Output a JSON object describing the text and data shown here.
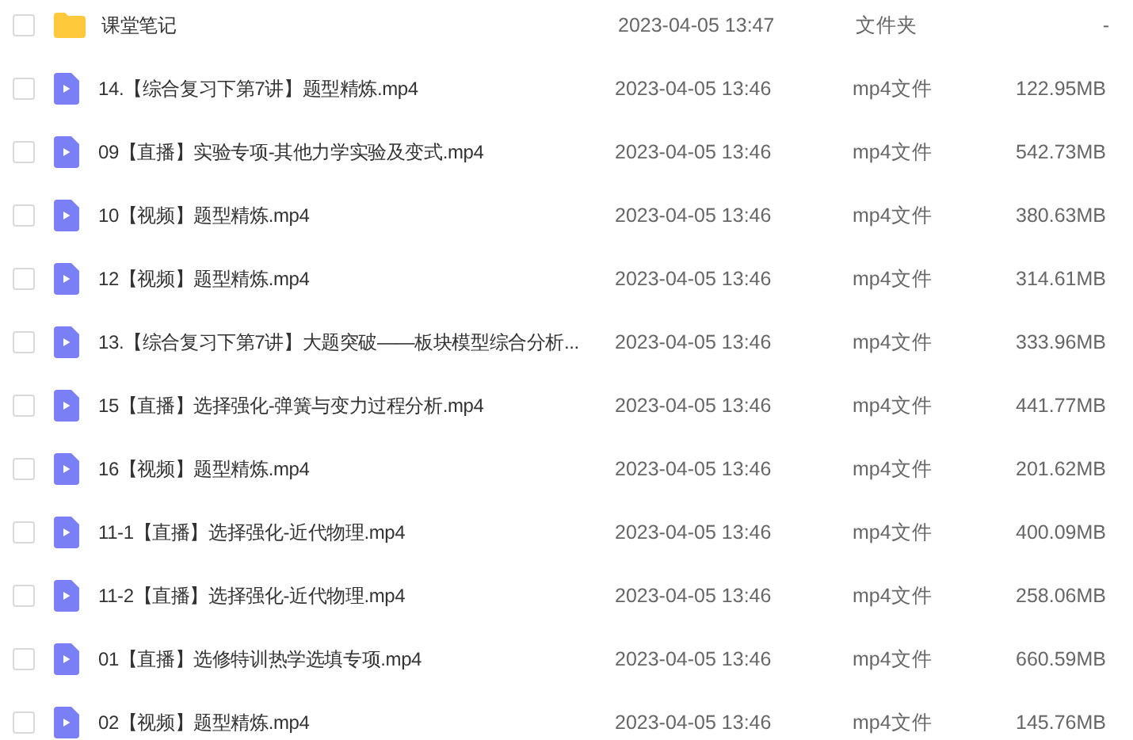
{
  "files": [
    {
      "kind": "folder",
      "checked": false,
      "name": "课堂笔记",
      "modified": "2023-04-05 13:47",
      "type": "文件夹",
      "size": "-"
    },
    {
      "kind": "video",
      "checked": false,
      "name": "14.【综合复习下第7讲】题型精炼.mp4",
      "modified": "2023-04-05 13:46",
      "type": "mp4文件",
      "size": "122.95MB"
    },
    {
      "kind": "video",
      "checked": false,
      "name": "09【直播】实验专项-其他力学实验及变式.mp4",
      "modified": "2023-04-05 13:46",
      "type": "mp4文件",
      "size": "542.73MB"
    },
    {
      "kind": "video",
      "checked": false,
      "name": "10【视频】题型精炼.mp4",
      "modified": "2023-04-05 13:46",
      "type": "mp4文件",
      "size": "380.63MB"
    },
    {
      "kind": "video",
      "checked": false,
      "name": "12【视频】题型精炼.mp4",
      "modified": "2023-04-05 13:46",
      "type": "mp4文件",
      "size": "314.61MB"
    },
    {
      "kind": "video",
      "checked": false,
      "name": "13.【综合复习下第7讲】大题突破——板块模型综合分析...",
      "modified": "2023-04-05 13:46",
      "type": "mp4文件",
      "size": "333.96MB"
    },
    {
      "kind": "video",
      "checked": false,
      "name": "15【直播】选择强化-弹簧与变力过程分析.mp4",
      "modified": "2023-04-05 13:46",
      "type": "mp4文件",
      "size": "441.77MB"
    },
    {
      "kind": "video",
      "checked": false,
      "name": "16【视频】题型精炼.mp4",
      "modified": "2023-04-05 13:46",
      "type": "mp4文件",
      "size": "201.62MB"
    },
    {
      "kind": "video",
      "checked": false,
      "name": "11-1【直播】选择强化-近代物理.mp4",
      "modified": "2023-04-05 13:46",
      "type": "mp4文件",
      "size": "400.09MB"
    },
    {
      "kind": "video",
      "checked": false,
      "name": "11-2【直播】选择强化-近代物理.mp4",
      "modified": "2023-04-05 13:46",
      "type": "mp4文件",
      "size": "258.06MB"
    },
    {
      "kind": "video",
      "checked": false,
      "name": "01【直播】选修特训热学选填专项.mp4",
      "modified": "2023-04-05 13:46",
      "type": "mp4文件",
      "size": "660.59MB"
    },
    {
      "kind": "video",
      "checked": false,
      "name": "02【视频】题型精炼.mp4",
      "modified": "2023-04-05 13:46",
      "type": "mp4文件",
      "size": "145.76MB"
    }
  ]
}
